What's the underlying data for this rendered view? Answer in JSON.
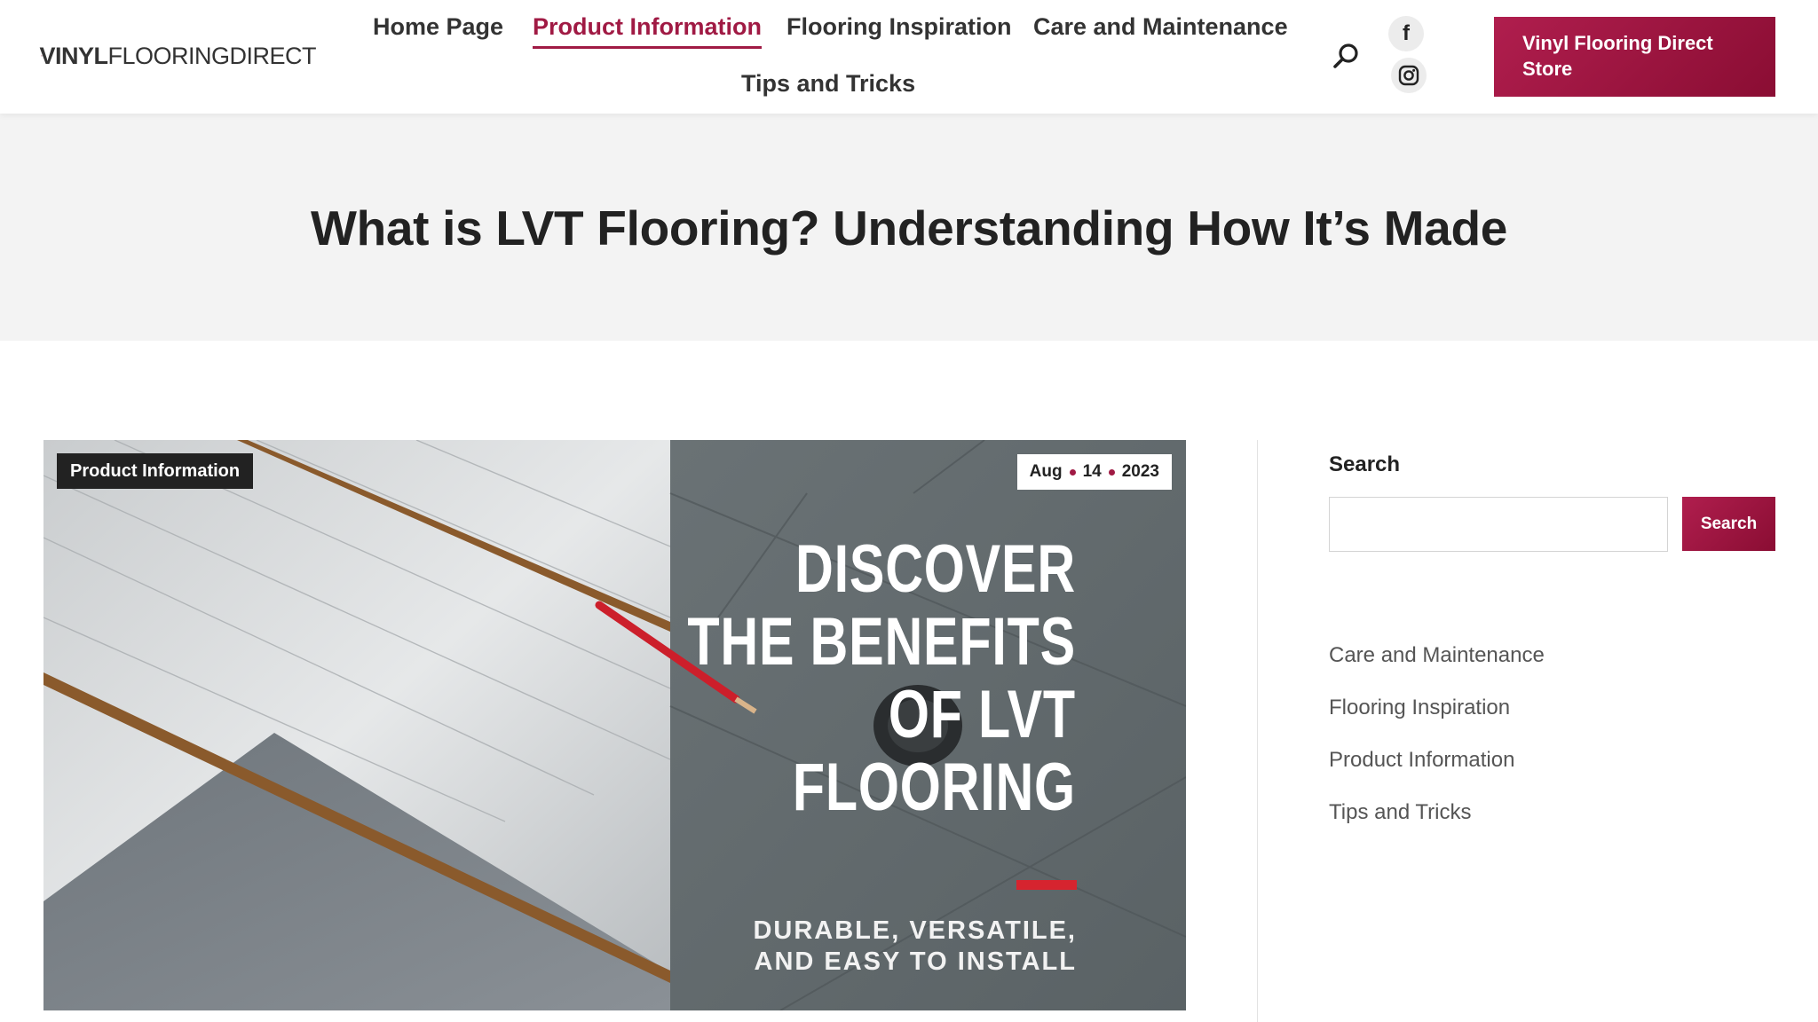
{
  "brand": {
    "logo_bold": "VINYL",
    "logo_regular": "FLOORINGDIRECT",
    "accent_color": "#a01a44"
  },
  "nav": {
    "items": [
      {
        "label": "Home Page",
        "active": false
      },
      {
        "label": "Product Information",
        "active": true
      },
      {
        "label": "Flooring Inspiration",
        "active": false
      },
      {
        "label": "Care and Maintenance",
        "active": false
      },
      {
        "label": "Tips and Tricks",
        "active": false
      }
    ],
    "search_icon": "search-icon",
    "social": [
      {
        "icon": "facebook-icon",
        "glyph": "f"
      },
      {
        "icon": "instagram-icon"
      }
    ],
    "store_button": "Vinyl Flooring Direct Store"
  },
  "page": {
    "title": "What is LVT Flooring? Understanding How It’s Made"
  },
  "post": {
    "category": "Product Information",
    "date": {
      "month": "Aug",
      "day": "14",
      "year": "2023"
    },
    "image_headline": [
      "DISCOVER",
      "THE BENEFITS",
      "OF LVT",
      "FLOORING"
    ],
    "image_subline": [
      "DURABLE, VERSATILE,",
      "AND EASY TO INSTALL"
    ]
  },
  "sidebar": {
    "search_title": "Search",
    "search_placeholder": "",
    "search_button": "Search",
    "categories": [
      "Care and Maintenance",
      "Flooring Inspiration",
      "Product Information",
      "Tips and Tricks"
    ]
  }
}
